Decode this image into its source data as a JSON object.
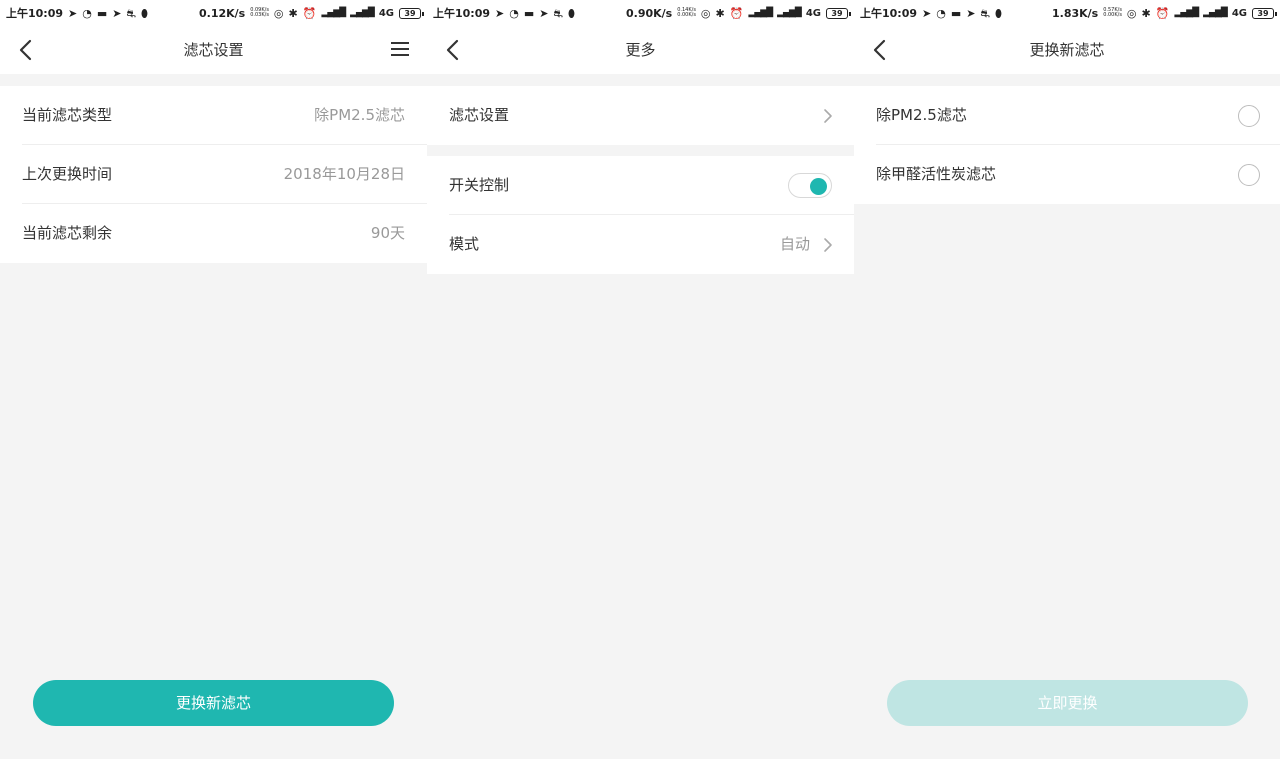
{
  "colors": {
    "accent": "#1fb7b0",
    "accent_disabled": "#bfe5e3",
    "background": "#f4f4f4"
  },
  "status_bars": [
    {
      "time": "上午10:09",
      "speed": "0.12K/s",
      "mini_top": "0.09K/s",
      "mini_bottom": "0.03K/s",
      "network": "4G",
      "battery": "39"
    },
    {
      "time": "上午10:09",
      "speed": "0.90K/s",
      "mini_top": "0.14K/s",
      "mini_bottom": "0.00K/s",
      "network": "4G",
      "battery": "39"
    },
    {
      "time": "上午10:09",
      "speed": "1.83K/s",
      "mini_top": "0.57K/s",
      "mini_bottom": "0.00K/s",
      "network": "4G",
      "battery": "39"
    }
  ],
  "screen1": {
    "title": "滤芯设置",
    "rows": [
      {
        "label": "当前滤芯类型",
        "value": "除PM2.5滤芯"
      },
      {
        "label": "上次更换时间",
        "value": "2018年10月28日"
      },
      {
        "label": "当前滤芯剩余",
        "value": "90天"
      }
    ],
    "button": "更换新滤芯"
  },
  "screen2": {
    "title": "更多",
    "filter_settings": "滤芯设置",
    "switch_control": "开关控制",
    "switch_on": true,
    "mode_label": "模式",
    "mode_value": "自动"
  },
  "screen3": {
    "title": "更换新滤芯",
    "options": [
      "除PM2.5滤芯",
      "除甲醛活性炭滤芯"
    ],
    "button": "立即更换"
  }
}
